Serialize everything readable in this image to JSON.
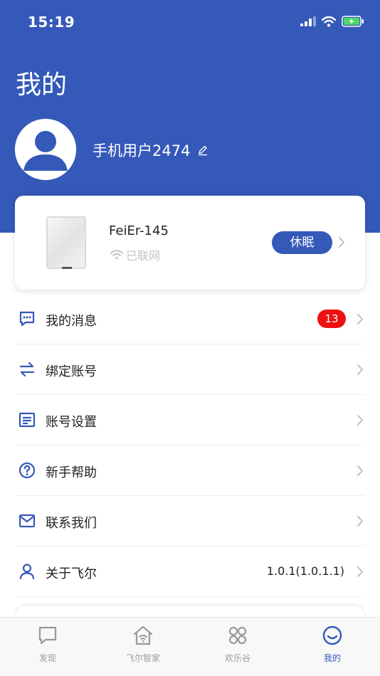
{
  "status_bar": {
    "time": "15:19"
  },
  "page": {
    "title": "我的"
  },
  "user": {
    "name": "手机用户2474"
  },
  "device": {
    "name": "FeiEr-145",
    "status": "已联网",
    "action_label": "休眠"
  },
  "menu": [
    {
      "label": "我的消息",
      "icon": "message-icon",
      "badge": "13"
    },
    {
      "label": "绑定账号",
      "icon": "swap-arrows-icon"
    },
    {
      "label": "账号设置",
      "icon": "account-settings-icon"
    },
    {
      "label": "新手帮助",
      "icon": "help-icon"
    },
    {
      "label": "联系我们",
      "icon": "mail-icon"
    },
    {
      "label": "关于飞尔",
      "icon": "user-icon",
      "value": "1.0.1(1.0.1.1)"
    }
  ],
  "tabs": [
    {
      "label": "发现",
      "icon": "chat-bubble-icon",
      "active": false
    },
    {
      "label": "飞尔智家",
      "icon": "smart-home-icon",
      "active": false
    },
    {
      "label": "欢乐谷",
      "icon": "grid-circles-icon",
      "active": false
    },
    {
      "label": "我的",
      "icon": "smile-icon",
      "active": true
    }
  ],
  "colors": {
    "brand": "#3559b9",
    "badge": "#ee1111",
    "inactive": "#9a9a9a"
  }
}
